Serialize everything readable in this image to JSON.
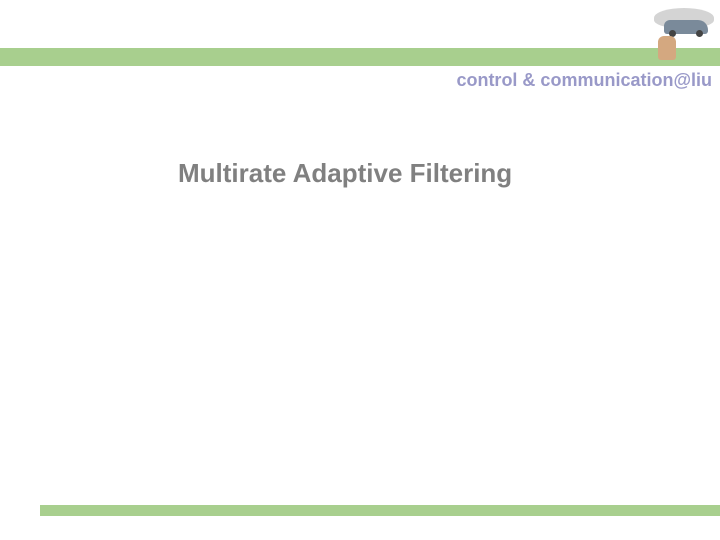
{
  "header": {
    "subtitle": "control & communication@liu"
  },
  "main": {
    "title": "Multirate Adaptive Filtering"
  }
}
